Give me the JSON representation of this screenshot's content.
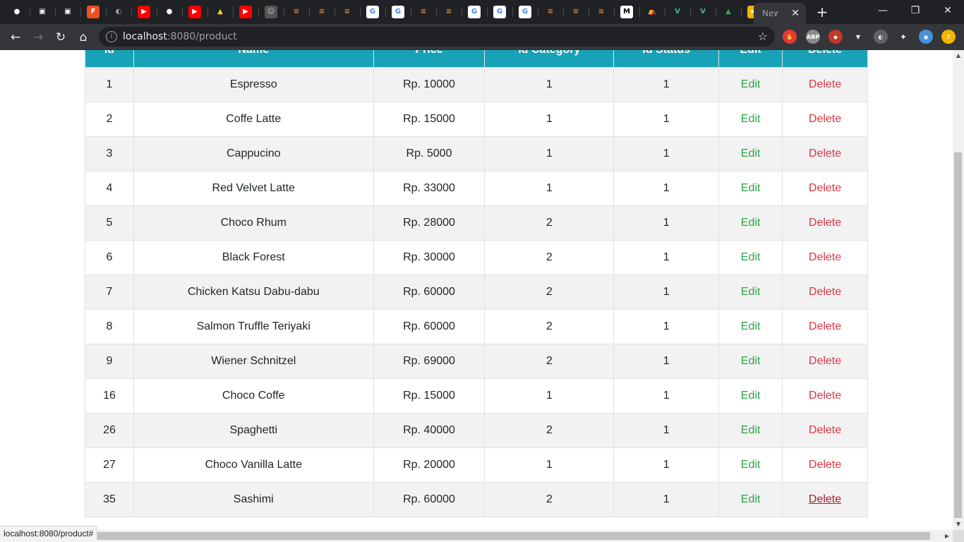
{
  "browser": {
    "tab_icons": [
      {
        "icon": "github-icon",
        "glyph": "●",
        "color": "#ffffff",
        "bg": "transparent"
      },
      {
        "icon": "monitor-icon",
        "glyph": "▣",
        "color": "#ffffff",
        "bg": "transparent"
      },
      {
        "icon": "monitor-icon",
        "glyph": "▣",
        "color": "#ffffff",
        "bg": "transparent"
      },
      {
        "icon": "figma-icon",
        "glyph": "F",
        "color": "#ffffff",
        "bg": "#f24e1e"
      },
      {
        "icon": "globe-icon",
        "glyph": "◐",
        "color": "#9aa0a6",
        "bg": "transparent"
      },
      {
        "icon": "youtube-icon",
        "glyph": "▶",
        "color": "#ffffff",
        "bg": "#ff0000"
      },
      {
        "icon": "github-icon",
        "glyph": "●",
        "color": "#ffffff",
        "bg": "transparent"
      },
      {
        "icon": "youtube-icon",
        "glyph": "▶",
        "color": "#ffffff",
        "bg": "#ff0000"
      },
      {
        "icon": "firebase-icon",
        "glyph": "▲",
        "color": "#ffca28",
        "bg": "transparent"
      },
      {
        "icon": "youtube-icon",
        "glyph": "▶",
        "color": "#ffffff",
        "bg": "#ff0000"
      },
      {
        "icon": "avatar-icon",
        "glyph": "☺",
        "color": "#cccccc",
        "bg": "#555555"
      },
      {
        "icon": "stackoverflow-icon",
        "glyph": "≡",
        "color": "#f48024",
        "bg": "transparent"
      },
      {
        "icon": "stackoverflow-icon",
        "glyph": "≡",
        "color": "#f48024",
        "bg": "transparent"
      },
      {
        "icon": "stackoverflow-icon",
        "glyph": "≡",
        "color": "#f48024",
        "bg": "transparent"
      },
      {
        "icon": "google-icon",
        "glyph": "G",
        "color": "#4285f4",
        "bg": "#ffffff"
      },
      {
        "icon": "google-icon",
        "glyph": "G",
        "color": "#4285f4",
        "bg": "#ffffff"
      },
      {
        "icon": "stackoverflow-icon",
        "glyph": "≡",
        "color": "#f48024",
        "bg": "transparent"
      },
      {
        "icon": "stackoverflow-icon",
        "glyph": "≡",
        "color": "#f48024",
        "bg": "transparent"
      },
      {
        "icon": "google-icon",
        "glyph": "G",
        "color": "#4285f4",
        "bg": "#ffffff"
      },
      {
        "icon": "google-icon",
        "glyph": "G",
        "color": "#4285f4",
        "bg": "#ffffff"
      },
      {
        "icon": "google-icon",
        "glyph": "G",
        "color": "#4285f4",
        "bg": "#ffffff"
      },
      {
        "icon": "stackoverflow-icon",
        "glyph": "≡",
        "color": "#f48024",
        "bg": "transparent"
      },
      {
        "icon": "stackoverflow-icon",
        "glyph": "≡",
        "color": "#f48024",
        "bg": "transparent"
      },
      {
        "icon": "stackoverflow-icon",
        "glyph": "≡",
        "color": "#f48024",
        "bg": "transparent"
      },
      {
        "icon": "medium-icon",
        "glyph": "M",
        "color": "#000000",
        "bg": "#ffffff"
      },
      {
        "icon": "tent-icon",
        "glyph": "⛺",
        "color": "#e8a33c",
        "bg": "transparent"
      },
      {
        "icon": "vue-icon",
        "glyph": "V",
        "color": "#42b883",
        "bg": "transparent"
      },
      {
        "icon": "vue-icon",
        "glyph": "V",
        "color": "#42b883",
        "bg": "transparent"
      },
      {
        "icon": "google-drive-icon",
        "glyph": "▲",
        "color": "#34a853",
        "bg": "transparent"
      },
      {
        "icon": "slides-icon",
        "glyph": "▬",
        "color": "#ffffff",
        "bg": "#f4b400"
      }
    ],
    "active_tab_label": "New Tab",
    "close_glyph": "✕",
    "newtab_glyph": "+",
    "minimize_glyph": "—",
    "restore_glyph": "❐",
    "close_window_glyph": "✕",
    "back_glyph": "←",
    "forward_glyph": "→",
    "reload_glyph": "↻",
    "home_glyph": "⌂",
    "info_glyph": "i",
    "url_host": "localhost",
    "url_rest": ":8080/product",
    "bookmark_glyph": "☆",
    "extensions": [
      {
        "icon": "adblock-icon",
        "glyph": "✋",
        "bg": "#e53935"
      },
      {
        "icon": "abp-icon",
        "glyph": "ABP",
        "bg": "#8a8a8a"
      },
      {
        "icon": "ext-red-icon",
        "glyph": "◆",
        "bg": "#c0392b"
      },
      {
        "icon": "vue-devtools-icon",
        "glyph": "▼",
        "bg": "#35363a"
      },
      {
        "icon": "ext-badge-icon",
        "glyph": "◐",
        "bg": "#5f6368"
      },
      {
        "icon": "puzzle-icon",
        "glyph": "✚",
        "bg": "#35363a"
      },
      {
        "icon": "profile-avatar-icon",
        "glyph": "◉",
        "bg": "#4a90d9"
      },
      {
        "icon": "update-icon",
        "glyph": "↑",
        "bg": "#f4b400"
      }
    ],
    "status_url": "localhost:8080/product#"
  },
  "table": {
    "columns": [
      "Id",
      "Name",
      "Price",
      "Id Category",
      "Id Status",
      "Edit",
      "Delete"
    ],
    "edit_label": "Edit",
    "delete_label": "Delete",
    "rows": [
      {
        "id": "1",
        "name": "Espresso",
        "price": "Rp. 10000",
        "category": "1",
        "status": "1"
      },
      {
        "id": "2",
        "name": "Coffe Latte",
        "price": "Rp. 15000",
        "category": "1",
        "status": "1"
      },
      {
        "id": "3",
        "name": "Cappucino",
        "price": "Rp. 5000",
        "category": "1",
        "status": "1"
      },
      {
        "id": "4",
        "name": "Red Velvet Latte",
        "price": "Rp. 33000",
        "category": "1",
        "status": "1"
      },
      {
        "id": "5",
        "name": "Choco Rhum",
        "price": "Rp. 28000",
        "category": "2",
        "status": "1"
      },
      {
        "id": "6",
        "name": "Black Forest",
        "price": "Rp. 30000",
        "category": "2",
        "status": "1"
      },
      {
        "id": "7",
        "name": "Chicken Katsu Dabu-dabu",
        "price": "Rp. 60000",
        "category": "2",
        "status": "1"
      },
      {
        "id": "8",
        "name": "Salmon Truffle Teriyaki",
        "price": "Rp. 60000",
        "category": "2",
        "status": "1"
      },
      {
        "id": "9",
        "name": "Wiener Schnitzel",
        "price": "Rp. 69000",
        "category": "2",
        "status": "1"
      },
      {
        "id": "16",
        "name": "Choco Coffe",
        "price": "Rp. 15000",
        "category": "1",
        "status": "1"
      },
      {
        "id": "26",
        "name": "Spaghetti",
        "price": "Rp. 40000",
        "category": "2",
        "status": "1"
      },
      {
        "id": "27",
        "name": "Choco Vanilla Latte",
        "price": "Rp. 20000",
        "category": "1",
        "status": "1"
      },
      {
        "id": "35",
        "name": "Sashimi",
        "price": "Rp. 60000",
        "category": "2",
        "status": "1"
      }
    ],
    "hovered_delete_row": 12
  },
  "colors": {
    "header_bg": "#17a2b8",
    "edit_link": "#28a745",
    "delete_link": "#dc3545"
  }
}
